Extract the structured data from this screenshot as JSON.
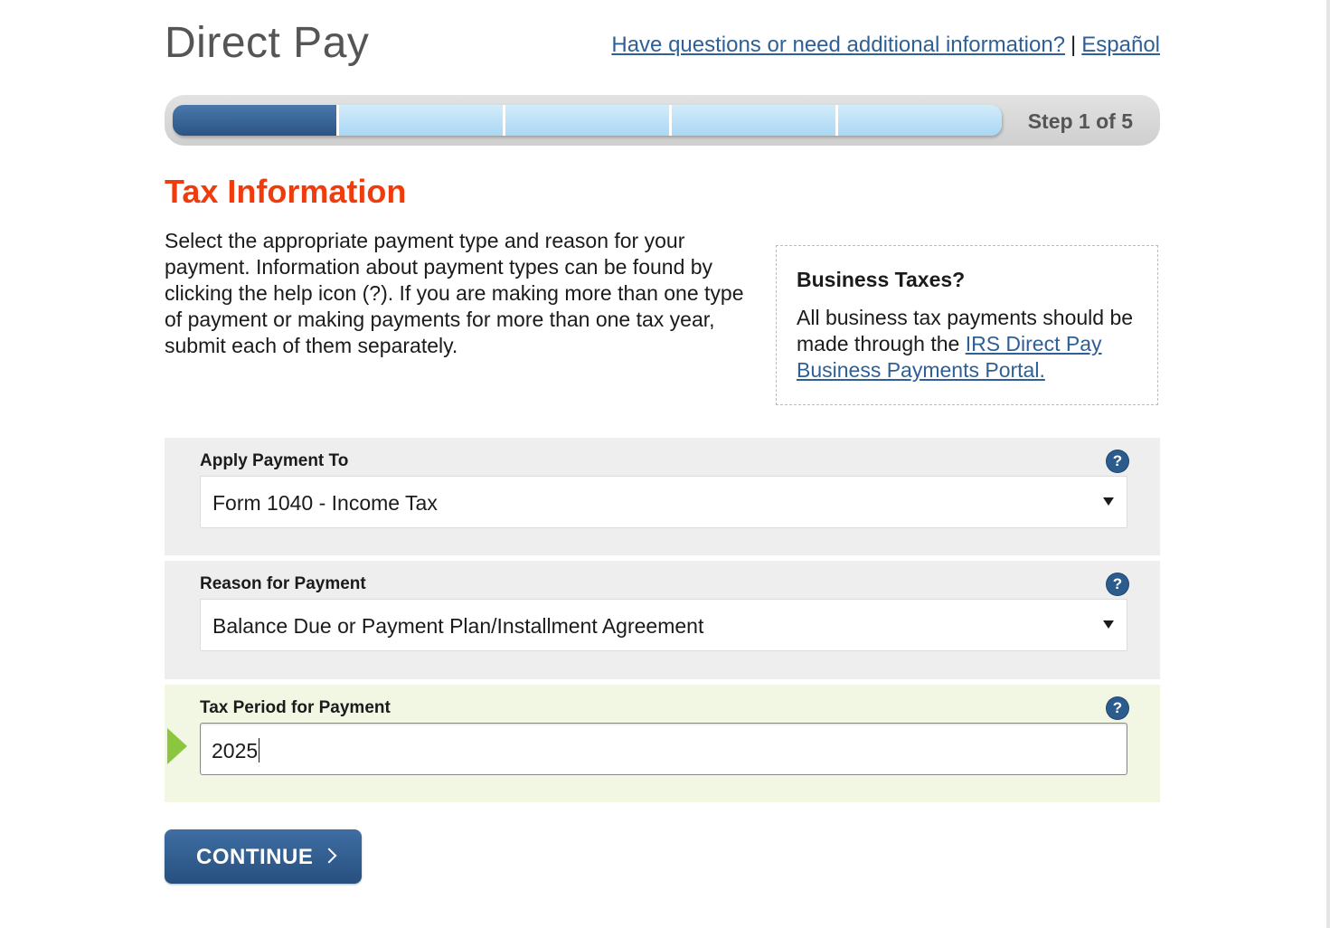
{
  "header": {
    "title": "Direct Pay",
    "help_link": "Have questions or need additional information?",
    "separator": "|",
    "language_link": "Español"
  },
  "progress": {
    "current_step": 1,
    "total_steps": 5,
    "label": "Step 1 of 5",
    "active_color": "#2e5f96",
    "inactive_color": "#b8def6"
  },
  "section": {
    "title": "Tax Information",
    "intro": "Select the appropriate payment type and reason for your payment. Information about payment types can be found by clicking the help icon (?). If you are making more than one type of payment or making payments for more than one tax year, submit each of them separately."
  },
  "business_box": {
    "title": "Business Taxes?",
    "text_before_link": "All business tax payments should be made through the ",
    "link": "IRS Direct Pay Business Payments Portal."
  },
  "form": {
    "apply_payment_to": {
      "label": "Apply Payment To",
      "value": "Form 1040 - Income Tax",
      "help_icon": "?"
    },
    "reason_for_payment": {
      "label": "Reason for Payment",
      "value": "Balance Due or Payment Plan/Installment Agreement",
      "help_icon": "?"
    },
    "tax_period": {
      "label": "Tax Period for Payment",
      "value": "2025",
      "help_icon": "?"
    }
  },
  "actions": {
    "continue_label": "CONTINUE"
  },
  "colors": {
    "title_orange": "#f03c0d",
    "link_blue": "#2e5f96",
    "button_blue": "#2e5f96",
    "marker_green": "#8cc63f"
  }
}
